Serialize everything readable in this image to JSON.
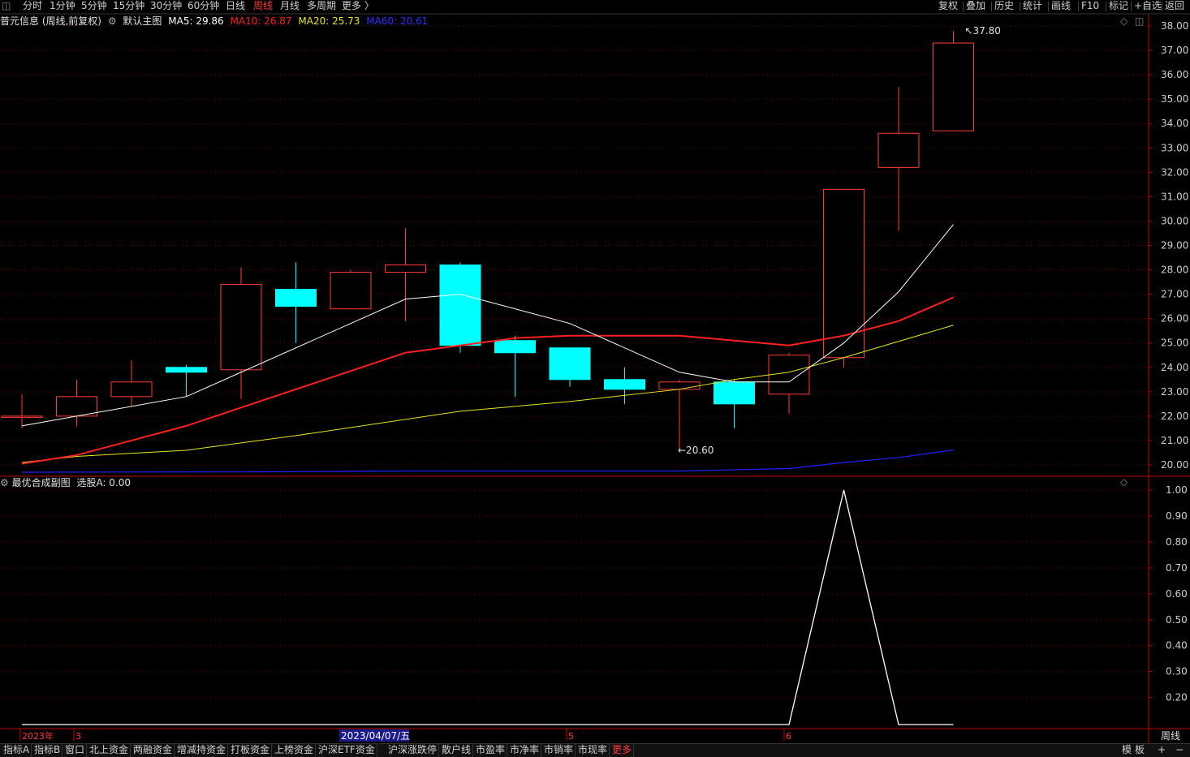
{
  "periods": [
    {
      "label": "分时",
      "active": false
    },
    {
      "label": "1分钟",
      "active": false
    },
    {
      "label": "5分钟",
      "active": false
    },
    {
      "label": "15分钟",
      "active": false
    },
    {
      "label": "30分钟",
      "active": false
    },
    {
      "label": "60分钟",
      "active": false
    },
    {
      "label": "日线",
      "active": false
    },
    {
      "label": "周线",
      "active": true
    },
    {
      "label": "月线",
      "active": false
    },
    {
      "label": "多周期",
      "active": false
    },
    {
      "label": "更多 〉",
      "active": false
    }
  ],
  "tools": [
    "复权",
    "叠加",
    "历史",
    "统计",
    "画线",
    "F10",
    "标记",
    "+自选",
    "返回"
  ],
  "legend": {
    "stock": "普元信息 (周线,前复权)",
    "template": "默认主图",
    "ma5": "MA5: 29.86",
    "ma10": "MA10: 26.87",
    "ma20": "MA20: 25.73",
    "ma60": "MA60: 20.61"
  },
  "sub_legend": {
    "name": "最优合成副图",
    "value": "选股A: 0.00"
  },
  "annotations": {
    "high": "37.80",
    "low": "20.60"
  },
  "colors": {
    "up": "#ff3b3b",
    "down": "#00ffff",
    "ma5": "#ffffff",
    "ma10": "#ff2020",
    "ma20": "#e6e620",
    "ma60": "#2020ff",
    "indicator": "#ffffff",
    "axis": "#c00000"
  },
  "chart_data": {
    "type": "candlestick",
    "period": "weekly",
    "price_axis": {
      "range": [
        19.6,
        38.2
      ],
      "ticks": [
        "20.00",
        "21.00",
        "22.00",
        "23.00",
        "24.00",
        "25.00",
        "26.00",
        "27.00",
        "28.00",
        "29.00",
        "30.00",
        "31.00",
        "32.00",
        "33.00",
        "34.00",
        "35.00",
        "36.00",
        "37.00",
        "38.00"
      ]
    },
    "x_labels": [
      {
        "index": 0,
        "text": "2023年"
      },
      {
        "index": 1,
        "text": "3"
      },
      {
        "index": 6,
        "text": "2023/04/07/五",
        "highlight": true
      },
      {
        "index": 10,
        "text": "5"
      },
      {
        "index": 14,
        "text": "6"
      }
    ],
    "candles": [
      {
        "o": 21.95,
        "c": 22.0,
        "h": 22.9,
        "l": 21.5
      },
      {
        "o": 22.0,
        "c": 22.8,
        "h": 23.5,
        "l": 21.6
      },
      {
        "o": 22.8,
        "c": 23.4,
        "h": 24.3,
        "l": 22.4
      },
      {
        "o": 24.0,
        "c": 23.8,
        "h": 24.1,
        "l": 22.8
      },
      {
        "o": 23.9,
        "c": 27.4,
        "h": 28.1,
        "l": 22.7
      },
      {
        "o": 27.2,
        "c": 26.5,
        "h": 28.3,
        "l": 25.0
      },
      {
        "o": 26.4,
        "c": 27.9,
        "h": 28.0,
        "l": 26.4
      },
      {
        "o": 27.9,
        "c": 28.2,
        "h": 29.7,
        "l": 25.9
      },
      {
        "o": 28.2,
        "c": 24.9,
        "h": 28.3,
        "l": 24.6
      },
      {
        "o": 25.1,
        "c": 24.6,
        "h": 25.3,
        "l": 22.8
      },
      {
        "o": 24.8,
        "c": 23.5,
        "h": 24.8,
        "l": 23.2
      },
      {
        "o": 23.5,
        "c": 23.1,
        "h": 24.0,
        "l": 22.5
      },
      {
        "o": 23.1,
        "c": 23.4,
        "h": 23.5,
        "l": 20.6
      },
      {
        "o": 23.4,
        "c": 22.5,
        "h": 23.5,
        "l": 21.5
      },
      {
        "o": 22.9,
        "c": 24.5,
        "h": 24.6,
        "l": 22.1
      },
      {
        "o": 24.4,
        "c": 31.3,
        "h": 31.3,
        "l": 24.0
      },
      {
        "o": 32.2,
        "c": 33.6,
        "h": 35.5,
        "l": 29.6
      },
      {
        "o": 33.7,
        "c": 37.3,
        "h": 37.8,
        "l": 33.7
      }
    ],
    "ma5": [
      21.6,
      null,
      null,
      22.8,
      null,
      null,
      null,
      26.8,
      27.0,
      null,
      25.8,
      null,
      23.8,
      23.4,
      23.4,
      25.0,
      27.1,
      29.86
    ],
    "ma10": [
      20.05,
      20.4,
      null,
      21.6,
      null,
      null,
      null,
      24.6,
      null,
      25.2,
      25.3,
      null,
      25.3,
      null,
      24.9,
      25.3,
      25.9,
      26.87
    ],
    "ma20": [
      20.1,
      20.35,
      null,
      20.6,
      null,
      21.2,
      null,
      null,
      22.2,
      null,
      22.6,
      null,
      23.1,
      23.5,
      23.8,
      24.4,
      null,
      25.73
    ],
    "ma60": [
      19.7,
      null,
      null,
      null,
      null,
      19.72,
      null,
      19.75,
      null,
      null,
      null,
      null,
      19.75,
      19.8,
      19.85,
      20.1,
      20.3,
      20.61
    ],
    "indicator": {
      "name": "选股A",
      "range": [
        0.08,
        1.05
      ],
      "ticks": [
        "0.20",
        "0.30",
        "0.40",
        "0.50",
        "0.60",
        "0.70",
        "0.80",
        "0.90",
        "1.00"
      ],
      "values": [
        0,
        0,
        0,
        0,
        0,
        0,
        0,
        0,
        0,
        0,
        0,
        0,
        0,
        0,
        0,
        1,
        0,
        0
      ]
    }
  },
  "bottom_tabs": [
    {
      "label": "指标A",
      "active": false
    },
    {
      "label": "指标B",
      "active": false
    },
    {
      "label": "窗口",
      "active": false
    },
    {
      "label": "北上资金",
      "active": false
    },
    {
      "label": "两融资金",
      "active": false
    },
    {
      "label": "增减持资金",
      "active": false
    },
    {
      "label": "打板资金",
      "active": false
    },
    {
      "label": "上榜资金",
      "active": false
    },
    {
      "label": "沪深ETF资金",
      "active": false
    },
    {
      "label": "沪深涨跌停",
      "active": false
    },
    {
      "label": "散户线",
      "active": false
    },
    {
      "label": "市盈率",
      "active": false
    },
    {
      "label": "市净率",
      "active": false
    },
    {
      "label": "市销率",
      "active": false
    },
    {
      "label": "市现率",
      "active": false
    },
    {
      "label": "更多",
      "active": true
    }
  ],
  "bottom_right": {
    "mode1": "模",
    "mode2": "板",
    "period": "周线",
    "plus": "+",
    "minus": "−"
  }
}
